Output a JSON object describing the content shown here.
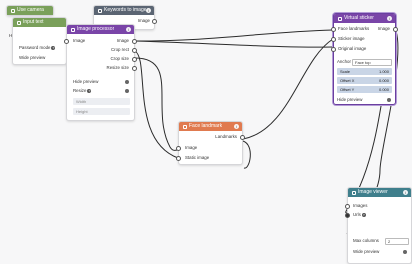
{
  "colors": {
    "green": "#7aa05a",
    "slate": "#5b6573",
    "purple": "#7a45a8",
    "orange": "#e07a4f",
    "teal": "#3f7f8c",
    "wire": "#2b2b2b"
  },
  "nodes": {
    "use_camera": {
      "title": "Use camera"
    },
    "input_text": {
      "title": "Input text",
      "password_mode": "Password mode",
      "wide_preview": "Wide preview",
      "trunc_a": "H",
      "trunc_b": "U"
    },
    "keywords": {
      "title": "Keywords to image",
      "out_image": "Image",
      "out_trunc": "Keyw"
    },
    "image_processor": {
      "title": "Image processor",
      "in_image": "Image",
      "out_image": "Image",
      "out_crop_rect": "Crop rect",
      "out_crop_size": "Crop size",
      "out_resize_size": "Resize size",
      "hide_preview": "Hide preview",
      "resize": "Resize",
      "width": "Width",
      "height": "Height"
    },
    "face_landmark": {
      "title": "Face landmark",
      "out_landmarks": "Landmarks",
      "in_image": "Image",
      "in_static": "Static image"
    },
    "virtual_sticker": {
      "title": "Virtual sticker",
      "in_face": "Face landmarks",
      "out_image": "Image",
      "in_sticker": "Sticker image",
      "in_original": "Original image",
      "anchor_label": "Anchor",
      "anchor_value": "Face top",
      "scale_label": "Scale",
      "scale_value": "1.000",
      "offsetx_label": "Offset X",
      "offsetx_value": "0.000",
      "offsety_label": "Offset Y",
      "offsety_value": "0.000",
      "hide_preview": "Hide preview"
    },
    "image_viewer": {
      "title": "Image viewer",
      "in_images": "Images",
      "in_urls": "Urls",
      "max_columns_label": "Max columns",
      "max_columns_value": "2",
      "wide_preview": "Wide preview"
    }
  }
}
